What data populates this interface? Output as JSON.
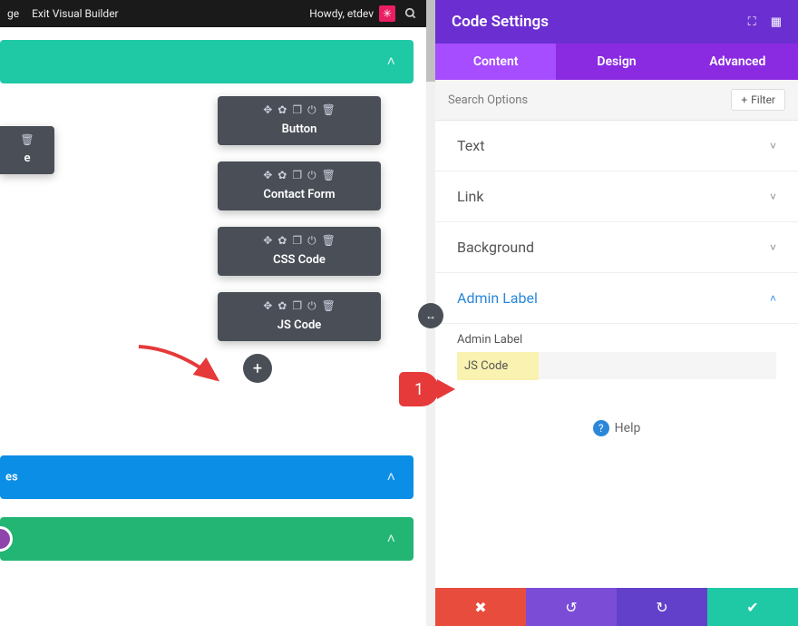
{
  "admin_bar": {
    "nav_left1": "ge",
    "nav_left2": "Exit Visual Builder",
    "greeting": "Howdy, etdev",
    "avatar_glyph": "✳"
  },
  "sections": {
    "teal_label": "",
    "blue_label": "es",
    "green_label": ""
  },
  "modules": [
    {
      "label": "Button"
    },
    {
      "label": "Contact Form"
    },
    {
      "label": "CSS Code"
    },
    {
      "label": "JS Code"
    }
  ],
  "partial_module": {
    "label": "e"
  },
  "panel": {
    "title": "Code Settings",
    "tabs": {
      "content": "Content",
      "design": "Design",
      "advanced": "Advanced"
    },
    "search_placeholder": "Search Options",
    "filter_label": "Filter",
    "options": {
      "text": "Text",
      "link": "Link",
      "background": "Background",
      "admin_label": "Admin Label"
    },
    "admin_label_field": "Admin Label",
    "admin_label_value": "JS Code",
    "help": "Help"
  },
  "callout_num": "1",
  "icons": {
    "move": "✥",
    "gear": "✿",
    "dup": "❐",
    "power": "⏻",
    "trash": "🗑",
    "chev_up": "˄",
    "chev_down": "˅",
    "plus": "+",
    "expand": "⛶",
    "grid": "▦",
    "search": "🔍",
    "close": "✖",
    "undo": "↺",
    "redo": "↻",
    "check": "✔",
    "resize": "↔"
  }
}
